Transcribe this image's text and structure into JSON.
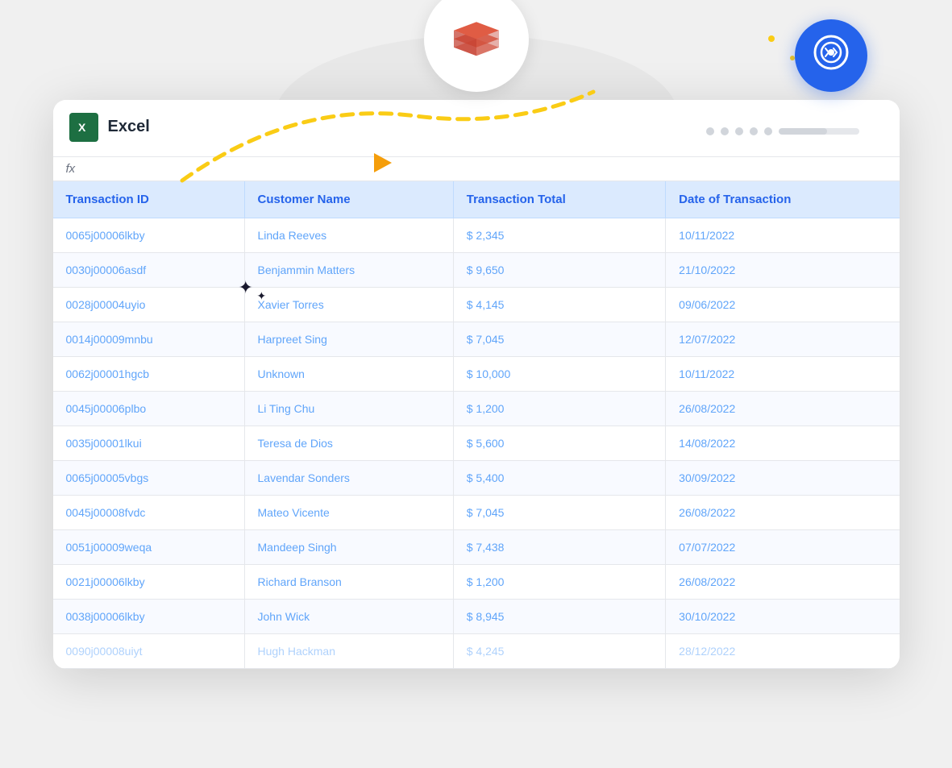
{
  "app": {
    "name": "Excel",
    "icon_letter": "X",
    "fx_label": "fx"
  },
  "top_dots": [
    "dot1",
    "dot2",
    "dot3",
    "dot4",
    "dot5"
  ],
  "table": {
    "headers": [
      "Transaction ID",
      "Customer Name",
      "Transaction Total",
      "Date of Transaction"
    ],
    "rows": [
      {
        "id": "0065j00006lkby",
        "customer": "Linda Reeves",
        "total": "$ 2,345",
        "date": "10/11/2022"
      },
      {
        "id": "0030j00006asdf",
        "customer": "Benjammin Matters",
        "total": "$ 9,650",
        "date": "21/10/2022"
      },
      {
        "id": "0028j00004uyio",
        "customer": "Xavier Torres",
        "total": "$ 4,145",
        "date": "09/06/2022"
      },
      {
        "id": "0014j00009mnbu",
        "customer": "Harpreet Sing",
        "total": "$ 7,045",
        "date": "12/07/2022"
      },
      {
        "id": "0062j00001hgcb",
        "customer": "Unknown",
        "total": "$ 10,000",
        "date": "10/11/2022"
      },
      {
        "id": "0045j00006plbo",
        "customer": "Li Ting Chu",
        "total": "$ 1,200",
        "date": "26/08/2022"
      },
      {
        "id": "0035j00001lkui",
        "customer": "Teresa de Dios",
        "total": "$ 5,600",
        "date": "14/08/2022"
      },
      {
        "id": "0065j00005vbgs",
        "customer": "Lavendar Sonders",
        "total": "$ 5,400",
        "date": "30/09/2022"
      },
      {
        "id": "0045j00008fvdc",
        "customer": "Mateo Vicente",
        "total": "$ 7,045",
        "date": "26/08/2022"
      },
      {
        "id": "0051j00009weqa",
        "customer": "Mandeep Singh",
        "total": "$ 7,438",
        "date": "07/07/2022"
      },
      {
        "id": "0021j00006lkby",
        "customer": "Richard Branson",
        "total": "$ 1,200",
        "date": "26/08/2022"
      },
      {
        "id": "0038j00006lkby",
        "customer": "John Wick",
        "total": "$ 8,945",
        "date": "30/10/2022"
      },
      {
        "id": "0090j00008uiyt",
        "customer": "Hugh Hackman",
        "total": "$ 4,245",
        "date": "28/12/2022"
      }
    ]
  },
  "colors": {
    "excel_green": "#1d6f42",
    "header_bg": "#dbeafe",
    "header_text": "#2563eb",
    "row_text": "#60a5fa",
    "dashed_arrow": "#facc15",
    "blue_circle": "#2563eb"
  }
}
